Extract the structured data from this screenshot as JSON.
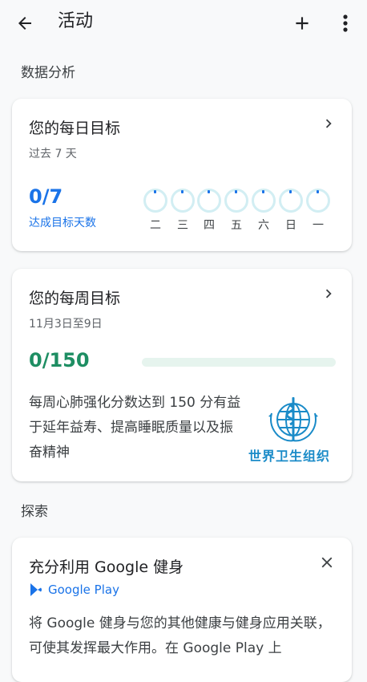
{
  "app": {
    "title": "活动"
  },
  "sections": {
    "analysis": "数据分析",
    "explore": "探索"
  },
  "daily_goal": {
    "title": "您的每日目标",
    "period": "过去 7 天",
    "count": "0/7",
    "count_label": "达成目标天数",
    "days": [
      "二",
      "三",
      "四",
      "五",
      "六",
      "日",
      "一"
    ],
    "achieved_fraction": 0
  },
  "weekly_goal": {
    "title": "您的每周目标",
    "period": "11月3日至9日",
    "count": "0/150",
    "progress_fraction": 0,
    "description": "每周心肺强化分数达到 150 分有益于延年益寿、提高睡眠质量以及振奋精神",
    "who_label": "世界卫生组织"
  },
  "explore_card": {
    "title": "充分利用 Google 健身",
    "store_label": "Google Play",
    "description": "将 Google 健身与您的其他健康与健身应用关联，可使其发挥最大作用。在 Google Play 上"
  },
  "colors": {
    "accent_blue": "#1a73e8",
    "accent_green": "#1e8e63",
    "who_blue": "#1a8bc8",
    "ring_empty": "#d2eef3"
  },
  "icons": {
    "back": "arrow-back-icon",
    "add": "plus-icon",
    "more": "more-vert-icon",
    "chevron": "chevron-right-icon",
    "close": "close-icon",
    "play": "google-play-icon",
    "who": "who-emblem"
  }
}
